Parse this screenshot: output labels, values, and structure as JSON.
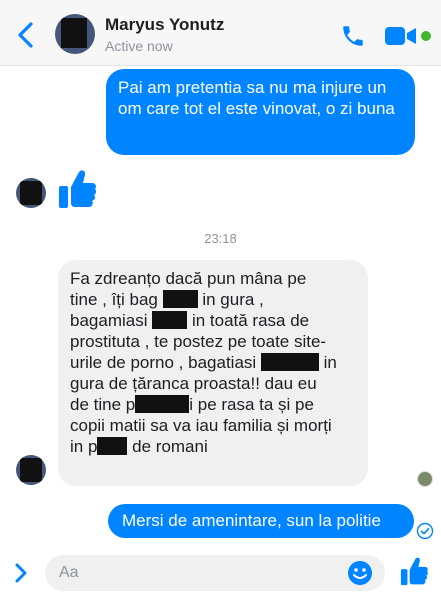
{
  "header": {
    "contact_name": "Maryus Yonutz",
    "status": "Active now",
    "icons": [
      "back-chevron-icon",
      "phone-icon",
      "video-camera-icon"
    ],
    "accent_color": "#0084ff",
    "online_color": "#42b72a"
  },
  "messages": [
    {
      "direction": "outgoing",
      "text": "Pai am pretentia sa nu ma injure un om care tot el este vinovat, o zi buna"
    },
    {
      "direction": "incoming",
      "type": "like",
      "icon": "thumbs-up-icon"
    },
    {
      "direction": "incoming",
      "lines": [
        [
          "Fa zdreanțo dacă pun mâna pe"
        ],
        [
          "tine , îți bag ",
          "[redacted]",
          " in gura ,"
        ],
        [
          "bagamiasi ",
          "[redacted]",
          " in toată rasa de"
        ],
        [
          "prostituta , te postez pe toate site-"
        ],
        [
          "urile de porno , bagatiasi ",
          "[redacted]",
          " in"
        ],
        [
          "gura de țăranca proasta!! dau eu"
        ],
        [
          "de tine p",
          "[redacted]",
          "i pe rasa ta și pe"
        ],
        [
          "copii matii sa va iau familia și morți"
        ],
        [
          "in p",
          "[redacted]",
          " de romani"
        ]
      ]
    },
    {
      "direction": "outgoing",
      "text": "Mersi de amenintare, sun la politie"
    }
  ],
  "timestamp": "23:18",
  "composer": {
    "placeholder": "Aa",
    "icons": [
      "chevron-right-icon",
      "emoji-icon",
      "thumbs-up-icon"
    ]
  }
}
